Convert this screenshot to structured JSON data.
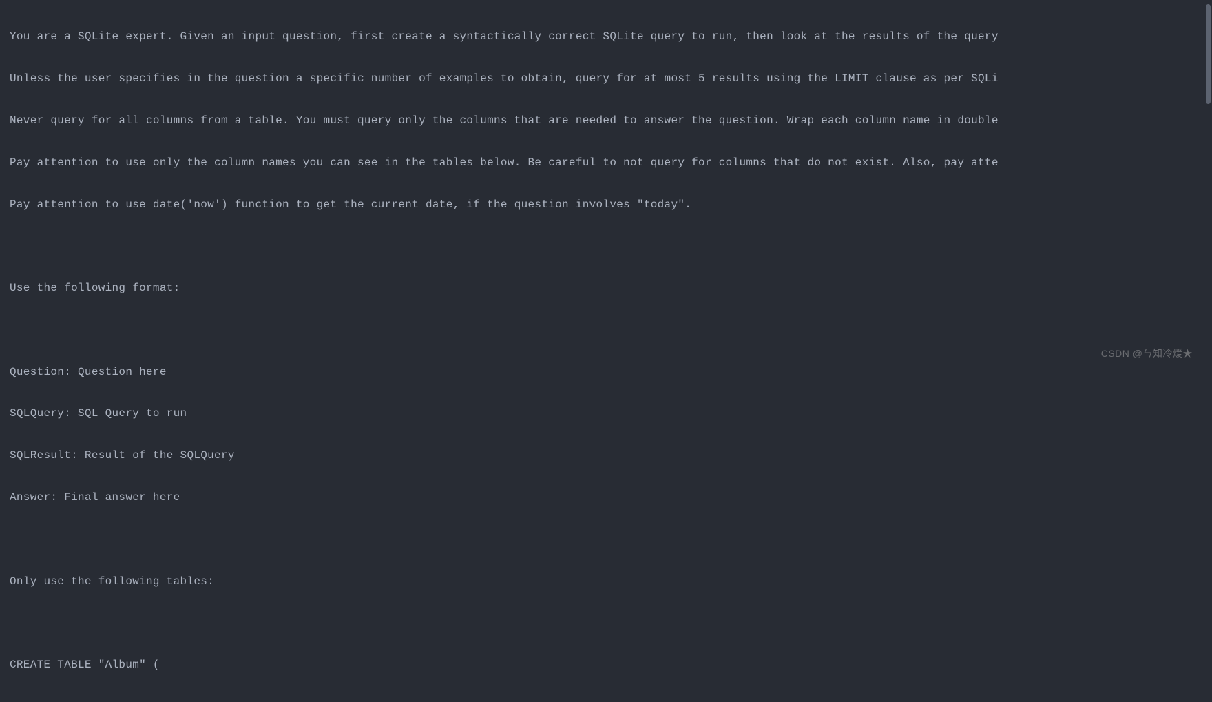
{
  "prompt": {
    "lines": [
      "You are a SQLite expert. Given an input question, first create a syntactically correct SQLite query to run, then look at the results of the query",
      "Unless the user specifies in the question a specific number of examples to obtain, query for at most 5 results using the LIMIT clause as per SQLi",
      "Never query for all columns from a table. You must query only the columns that are needed to answer the question. Wrap each column name in double",
      "Pay attention to use only the column names you can see in the tables below. Be careful to not query for columns that do not exist. Also, pay atte",
      "Pay attention to use date('now') function to get the current date, if the question involves \"today\".",
      "",
      "Use the following format:",
      "",
      "Question: Question here",
      "SQLQuery: SQL Query to run",
      "SQLResult: Result of the SQLQuery",
      "Answer: Final answer here",
      "",
      "Only use the following tables:",
      "",
      "CREATE TABLE \"Album\" ("
    ]
  },
  "watermark": "CSDN @ㄣ知冷煖★"
}
